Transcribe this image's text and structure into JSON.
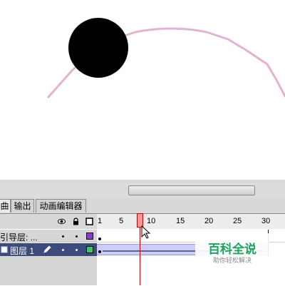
{
  "tabs": [
    {
      "label": "曲"
    },
    {
      "label": "输出"
    },
    {
      "label": "动画编辑器"
    }
  ],
  "frame_numbers": [
    "1",
    "5",
    "10",
    "15",
    "20",
    "25",
    "30"
  ],
  "layers": [
    {
      "name": "引导层: ...",
      "color": "#8c3cc8"
    },
    {
      "name": "图层 1",
      "color": "#33cc66"
    }
  ],
  "current_frame": 9,
  "watermark": {
    "title": "百科全说",
    "subtitle": "助你轻松解决"
  },
  "colors": {
    "guide_path": "#e0b4d0",
    "ball": "#000000",
    "tween": "#ccccff",
    "playhead": "#ff9a9a"
  },
  "icons": {
    "eye": "eye-icon",
    "lock": "lock-icon",
    "outline": "outline-square-icon",
    "pencil": "pencil-icon",
    "layer": "layer-icon",
    "cursor": "arrow-cursor-icon"
  }
}
